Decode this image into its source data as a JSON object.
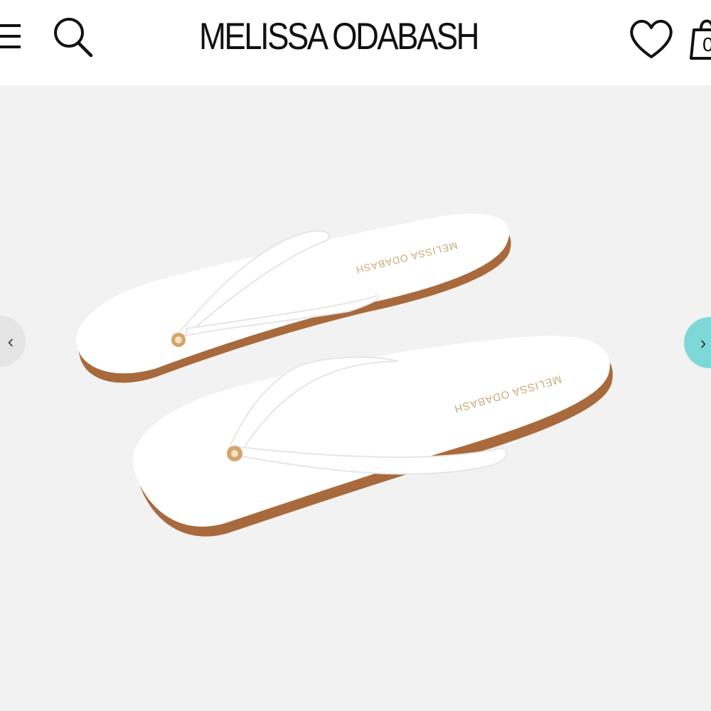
{
  "header": {
    "brand": "MELISSA ODABASH",
    "icons": {
      "menu": "hamburger-menu-icon",
      "search": "search-icon",
      "wishlist": "heart-icon",
      "bag": "shopping-bag-icon"
    },
    "bag_count": "0"
  },
  "gallery": {
    "sole_brand_1": "MELISSA ODABASH",
    "sole_brand_2": "MELISSA ODABASH",
    "prev_label": "‹",
    "next_label": "›"
  },
  "colors": {
    "accent": "#7fd8d8",
    "background": "#f2f2f2",
    "sole_edge": "#a86a3c"
  }
}
